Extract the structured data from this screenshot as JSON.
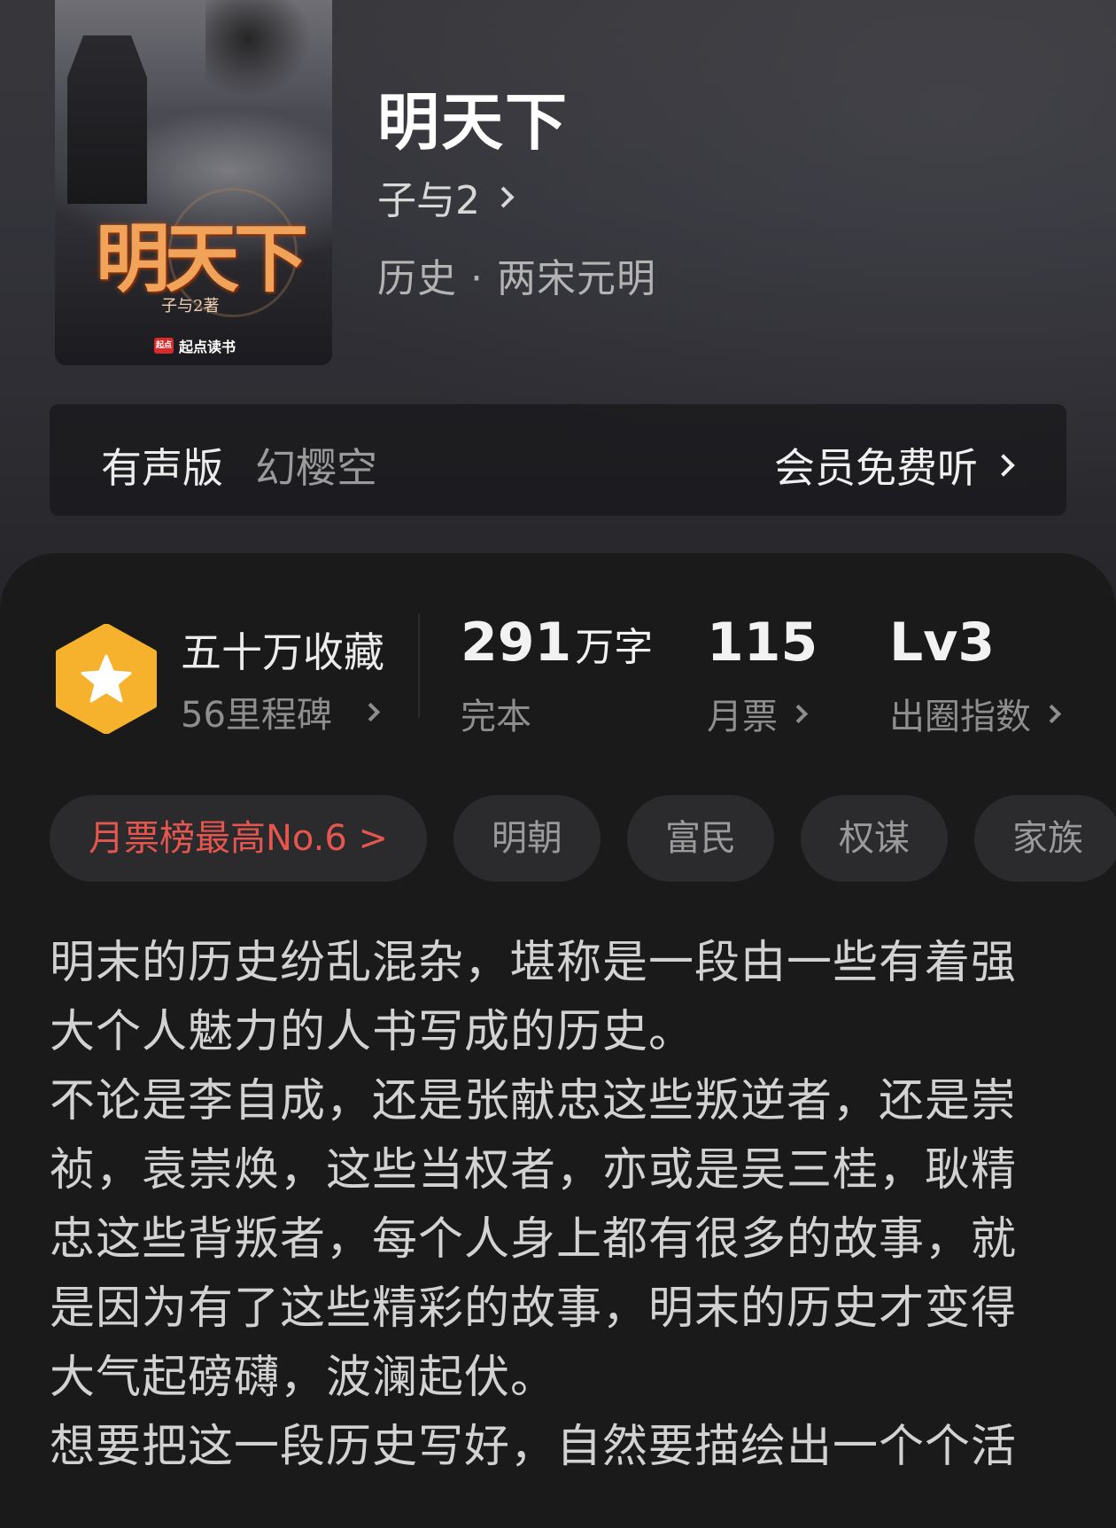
{
  "book": {
    "title": "明天下",
    "author": "子与2",
    "genre": "历史 · 两宋元明",
    "cover": {
      "title_art": "明天下",
      "author_art": "子与2著",
      "brand": "起点读书",
      "brand_logo": "起点"
    }
  },
  "audio": {
    "label": "有声版",
    "narrator": "幻樱空",
    "action": "会员免费听"
  },
  "stats": {
    "collection": {
      "main": "五十万收藏",
      "sub": "56里程碑"
    },
    "words": {
      "number": "291",
      "unit": "万字",
      "sub": "完本"
    },
    "tickets": {
      "number": "115",
      "sub": "月票"
    },
    "level": {
      "number": "Lv3",
      "sub": "出圈指数"
    }
  },
  "tags": [
    "月票榜最高No.6 >",
    "明朝",
    "富民",
    "权谋",
    "家族"
  ],
  "description": [
    "明末的历史纷乱混杂，堪称是一段由一些有着强大个人魅力的人书写成的历史。",
    "不论是李自成，还是张献忠这些叛逆者，还是崇祯，袁崇焕，这些当权者，亦或是吴三桂，耿精忠这些背叛者，每个人身上都有很多的故事，就是因为有了这些精彩的故事，明末的历史才变得大气起磅礴，波澜起伏。",
    "想要把这一段历史写好，自然要描绘出一个个活"
  ],
  "colors": {
    "accent_red": "#e5574e",
    "badge_orange": "#f6b12d",
    "background": "#1a1a1a"
  }
}
